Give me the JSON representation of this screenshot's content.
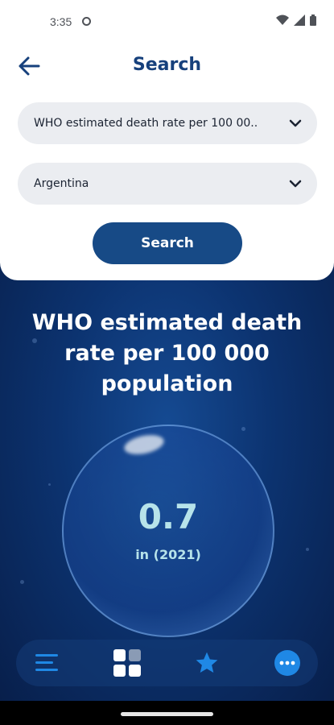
{
  "status_bar": {
    "time": "3:35"
  },
  "header": {
    "title": "Search"
  },
  "filters": {
    "indicator": "WHO estimated death rate per 100 00..",
    "country": "Argentina"
  },
  "search_button": "Search",
  "result": {
    "title": "WHO estimated death rate per 100 000 population",
    "value": "0.7",
    "year": "in (2021)"
  },
  "nav": {
    "icons": [
      "menu-icon",
      "grid-icon",
      "star-icon",
      "more-icon"
    ]
  },
  "colors": {
    "primary": "#174a86",
    "title": "#16407c",
    "value": "#b7e3ea",
    "accent": "#1f88e5"
  }
}
